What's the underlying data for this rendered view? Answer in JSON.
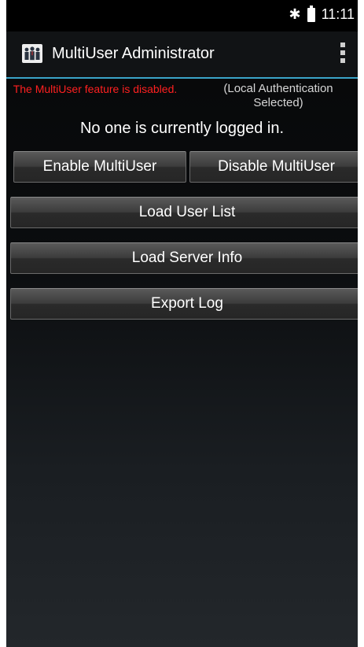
{
  "status_bar": {
    "bluetooth_icon": "bluetooth-icon",
    "battery_icon": "battery-icon",
    "time": "11:11"
  },
  "action_bar": {
    "app_icon": "multiuser-people-icon",
    "title": "MultiUser Administrator",
    "overflow_icon": "overflow-menu-icon",
    "accent_color": "#3aa4c8"
  },
  "status": {
    "feature_state": "The MultiUser feature is disabled.",
    "feature_state_color": "#ff2020",
    "auth_mode": "(Local Authentication Selected)",
    "login_status": "No one is currently logged in."
  },
  "buttons": {
    "enable": "Enable MultiUser",
    "disable": "Disable MultiUser",
    "load_user_list": "Load User List",
    "load_server_info": "Load Server Info",
    "export_log": "Export Log"
  }
}
